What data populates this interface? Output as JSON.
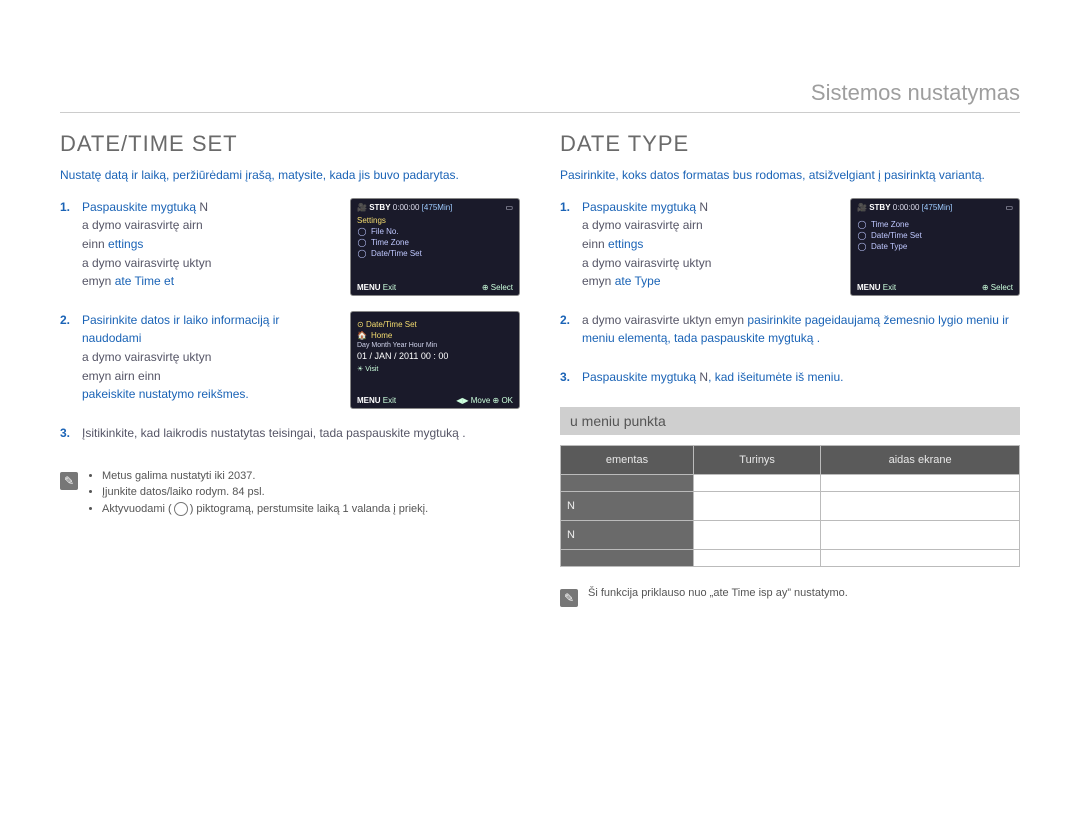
{
  "breadcrumb": "Sistemos nustatymas",
  "left": {
    "title": "DATE/TIME SET",
    "intro": "Nustatę datą ir laiką, peržiūrėdami įrašą, matysite, kada jis buvo padarytas.",
    "steps": [
      {
        "num": "1.",
        "body_parts": [
          "Paspauskite mygtuką ",
          "N",
          " ",
          "a",
          "dymo vairasvirtę ",
          "airn",
          " einn ",
          " ",
          "ettings",
          " ",
          "a",
          "dymo vairasvirtę ",
          "uktyn",
          " emyn ",
          " ",
          "ate Time et",
          ""
        ]
      },
      {
        "num": "2.",
        "lead": "Pasirinkite datos ir laiko informaciją ir naudodami ",
        "rest": "a dymo vairasvirtę uktyn emyn airn einn pakeiskite nustatymo reikšmes."
      },
      {
        "num": "3.",
        "text": "Įsitikinkite, kad laikrodis nustatytas teisingai, tada paspauskite mygtuką ."
      }
    ],
    "screenshot1": {
      "stby": "STBY",
      "time": "0:00:00",
      "remain": "[475Min]",
      "heading": "Settings",
      "rows": [
        "File No.",
        "Time Zone",
        "Date/Time Set"
      ],
      "bottom_left": "MENU",
      "bottom_left_t": "Exit",
      "bottom_right": "Select"
    },
    "screenshot2": {
      "heading": "Date/Time Set",
      "home": "Home",
      "labels": "Day  Month  Year  Hour  Min",
      "values": "01 / JAN / 2011   00 : 00",
      "visit": "Visit",
      "move": "Move",
      "ok": "OK",
      "bottom_left": "MENU",
      "bottom_left_t": "Exit"
    },
    "notes": [
      "Metus galima nustatyti iki 2037.",
      "Įjunkite datos/laiko rodym.  84 psl.",
      "Aktyvuodami (☀) piktogramą, perstumsite laiką 1 valanda į priekį."
    ]
  },
  "right": {
    "title": "DATE TYPE",
    "intro": "Pasirinkite, koks datos formatas bus rodomas, atsižvelgiant į pasirinktą variantą.",
    "steps": [
      {
        "num": "1.",
        "text": "Paspauskite mygtuką N  a dymo vairasvirtę airn einn  ettings  a dymo vairasvirtę uktyn emyn   ate Type ."
      },
      {
        "num": "2.",
        "lead": "a dymo vairasvirte uktyn emyn",
        "rest": " pasirinkite pageidaujamą žemesnio lygio meniu ir meniu elementą, tada paspauskite mygtuką ."
      },
      {
        "num": "3.",
        "lead": "Paspauskite mygtuką ",
        "mid": "N",
        "rest": ", kad išeitumėte iš meniu."
      }
    ],
    "screenshot": {
      "stby": "STBY",
      "time": "0:00:00",
      "remain": "[475Min]",
      "rows": [
        "Time Zone",
        "Date/Time Set",
        "Date Type"
      ],
      "bottom_left": "MENU",
      "bottom_left_t": "Exit",
      "bottom_right": "Select"
    },
    "submenu_title": "u meniu punkta",
    "table": {
      "headers": [
        "ementas",
        "Turinys",
        "aidas ekrane"
      ],
      "rows": [
        [
          "",
          "",
          ""
        ],
        [
          "N",
          "",
          ""
        ],
        [
          "N",
          "",
          ""
        ],
        [
          "",
          "",
          ""
        ]
      ]
    },
    "note": "Ši funkcija priklauso nuo „ate Time isp ay” nustatymo."
  }
}
